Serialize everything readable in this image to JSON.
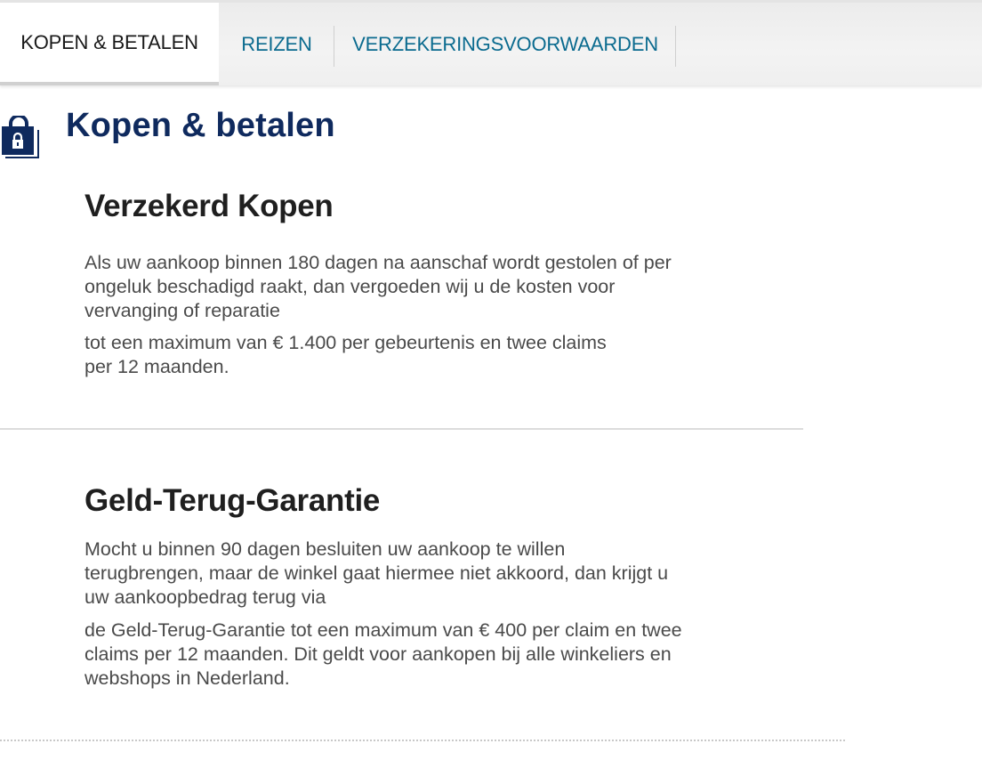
{
  "tabs": [
    {
      "label": "KOPEN & BETALEN",
      "active": true
    },
    {
      "label": "REIZEN",
      "active": false
    },
    {
      "label": "VERZEKERINGSVOORWAARDEN",
      "active": false
    }
  ],
  "section": {
    "icon": "shopping-bag-lock-icon",
    "title": "Kopen & betalen"
  },
  "items": [
    {
      "title": "Verzekerd Kopen",
      "paragraph1": "Als uw aankoop binnen 180 dagen na aanschaf wordt gestolen of per ongeluk beschadigd raakt, dan vergoeden wij u de kosten voor vervanging of reparatie",
      "paragraph2": "tot een maximum van € 1.400 per gebeurtenis en twee claims per 12 maanden."
    },
    {
      "title": "Geld-Terug-Garantie",
      "paragraph1": "Mocht u binnen 90 dagen besluiten uw aankoop te willen terugbrengen, maar de winkel gaat hiermee niet akkoord, dan krijgt u uw aankoopbedrag terug via",
      "paragraph2": "de Geld-Terug-Garantie tot een maximum van € 400 per claim en twee claims per 12 maanden. Dit geldt voor aankopen bij alle winkeliers en webshops in Nederland."
    }
  ],
  "colors": {
    "tab_link": "#0b6b8f",
    "section_title": "#0f2a5e",
    "icon_blue": "#0f2a5e"
  }
}
